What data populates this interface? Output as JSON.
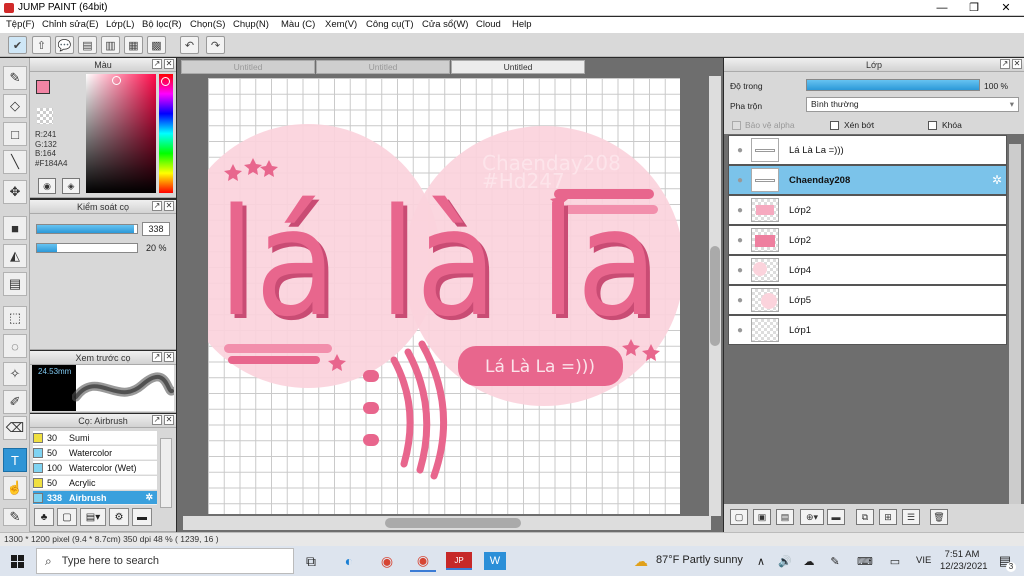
{
  "window": {
    "title": "JUMP PAINT (64bit)",
    "minimize": "—",
    "maximize": "❐",
    "close": "✕"
  },
  "menu": [
    "Tệp(F)",
    "Chỉnh sửa(E)",
    "Lớp(L)",
    "Bộ lọc(R)",
    "Chọn(S)",
    "Chụp(N)",
    "Màu (C)",
    "Xem(V)",
    "Công cụ(T)",
    "Cửa sổ(W)",
    "Cloud",
    "Help"
  ],
  "document_tabs": [
    "Untitled",
    "Untitled",
    "Untitled"
  ],
  "color_panel": {
    "title": "Màu",
    "r": "R:241",
    "g": "G:132",
    "b": "B:164",
    "hex": "#F184A4",
    "current_color": "#F184A4"
  },
  "brush_control": {
    "title": "Kiểm soát cọ",
    "size_value": "338",
    "opacity_value": "20 %",
    "size_fill": 0.97,
    "opacity_fill": 0.2
  },
  "brush_preview": {
    "title": "Xem trước cọ",
    "size_label": "24.53mm"
  },
  "brush_list": {
    "title": "Cọ: Airbrush",
    "items": [
      {
        "size": "30",
        "name": "Sumi",
        "color": "#f0e040"
      },
      {
        "size": "50",
        "name": "Watercolor",
        "color": "#7fd3f2"
      },
      {
        "size": "100",
        "name": "Watercolor (Wet)",
        "color": "#7fd3f2"
      },
      {
        "size": "50",
        "name": "Acrylic",
        "color": "#f0e040"
      },
      {
        "size": "338",
        "name": "Airbrush",
        "color": "#7fd3f2"
      }
    ]
  },
  "artwork": {
    "main_text": "lá là la",
    "watermark_line1": "Chaenday208",
    "watermark_line2": "#Hd247",
    "badge_text": "Lá Là La =)))",
    "accent": "#e8668d",
    "light": "#fbd3dc"
  },
  "layers_panel": {
    "title": "Lớp",
    "opacity_label": "Độ trong",
    "opacity_value": "100 %",
    "opacity_fill": 1.0,
    "blend_label": "Pha trộn",
    "blend_value": "Bình thường",
    "protect_alpha": "Bảo vệ alpha",
    "clip": "Xén bớt",
    "lock": "Khóa",
    "layers": [
      {
        "name": "Lá Là La =)))",
        "selected": false
      },
      {
        "name": "Chaenday208",
        "selected": true
      },
      {
        "name": "Lớp2",
        "selected": false
      },
      {
        "name": "Lớp2",
        "selected": false
      },
      {
        "name": "Lớp4",
        "selected": false
      },
      {
        "name": "Lớp5",
        "selected": false
      },
      {
        "name": "Lớp1",
        "selected": false
      }
    ]
  },
  "status": {
    "text": "1300 * 1200 pixel  (9.4 * 8.7cm)  350 dpi  48 %  ( 1239, 16 )"
  },
  "taskbar": {
    "search_placeholder": "Type here to search",
    "weather": "87°F  Partly sunny",
    "lang": "VIE",
    "time": "7:51 AM",
    "date": "12/23/2021",
    "notification_count": "3"
  }
}
